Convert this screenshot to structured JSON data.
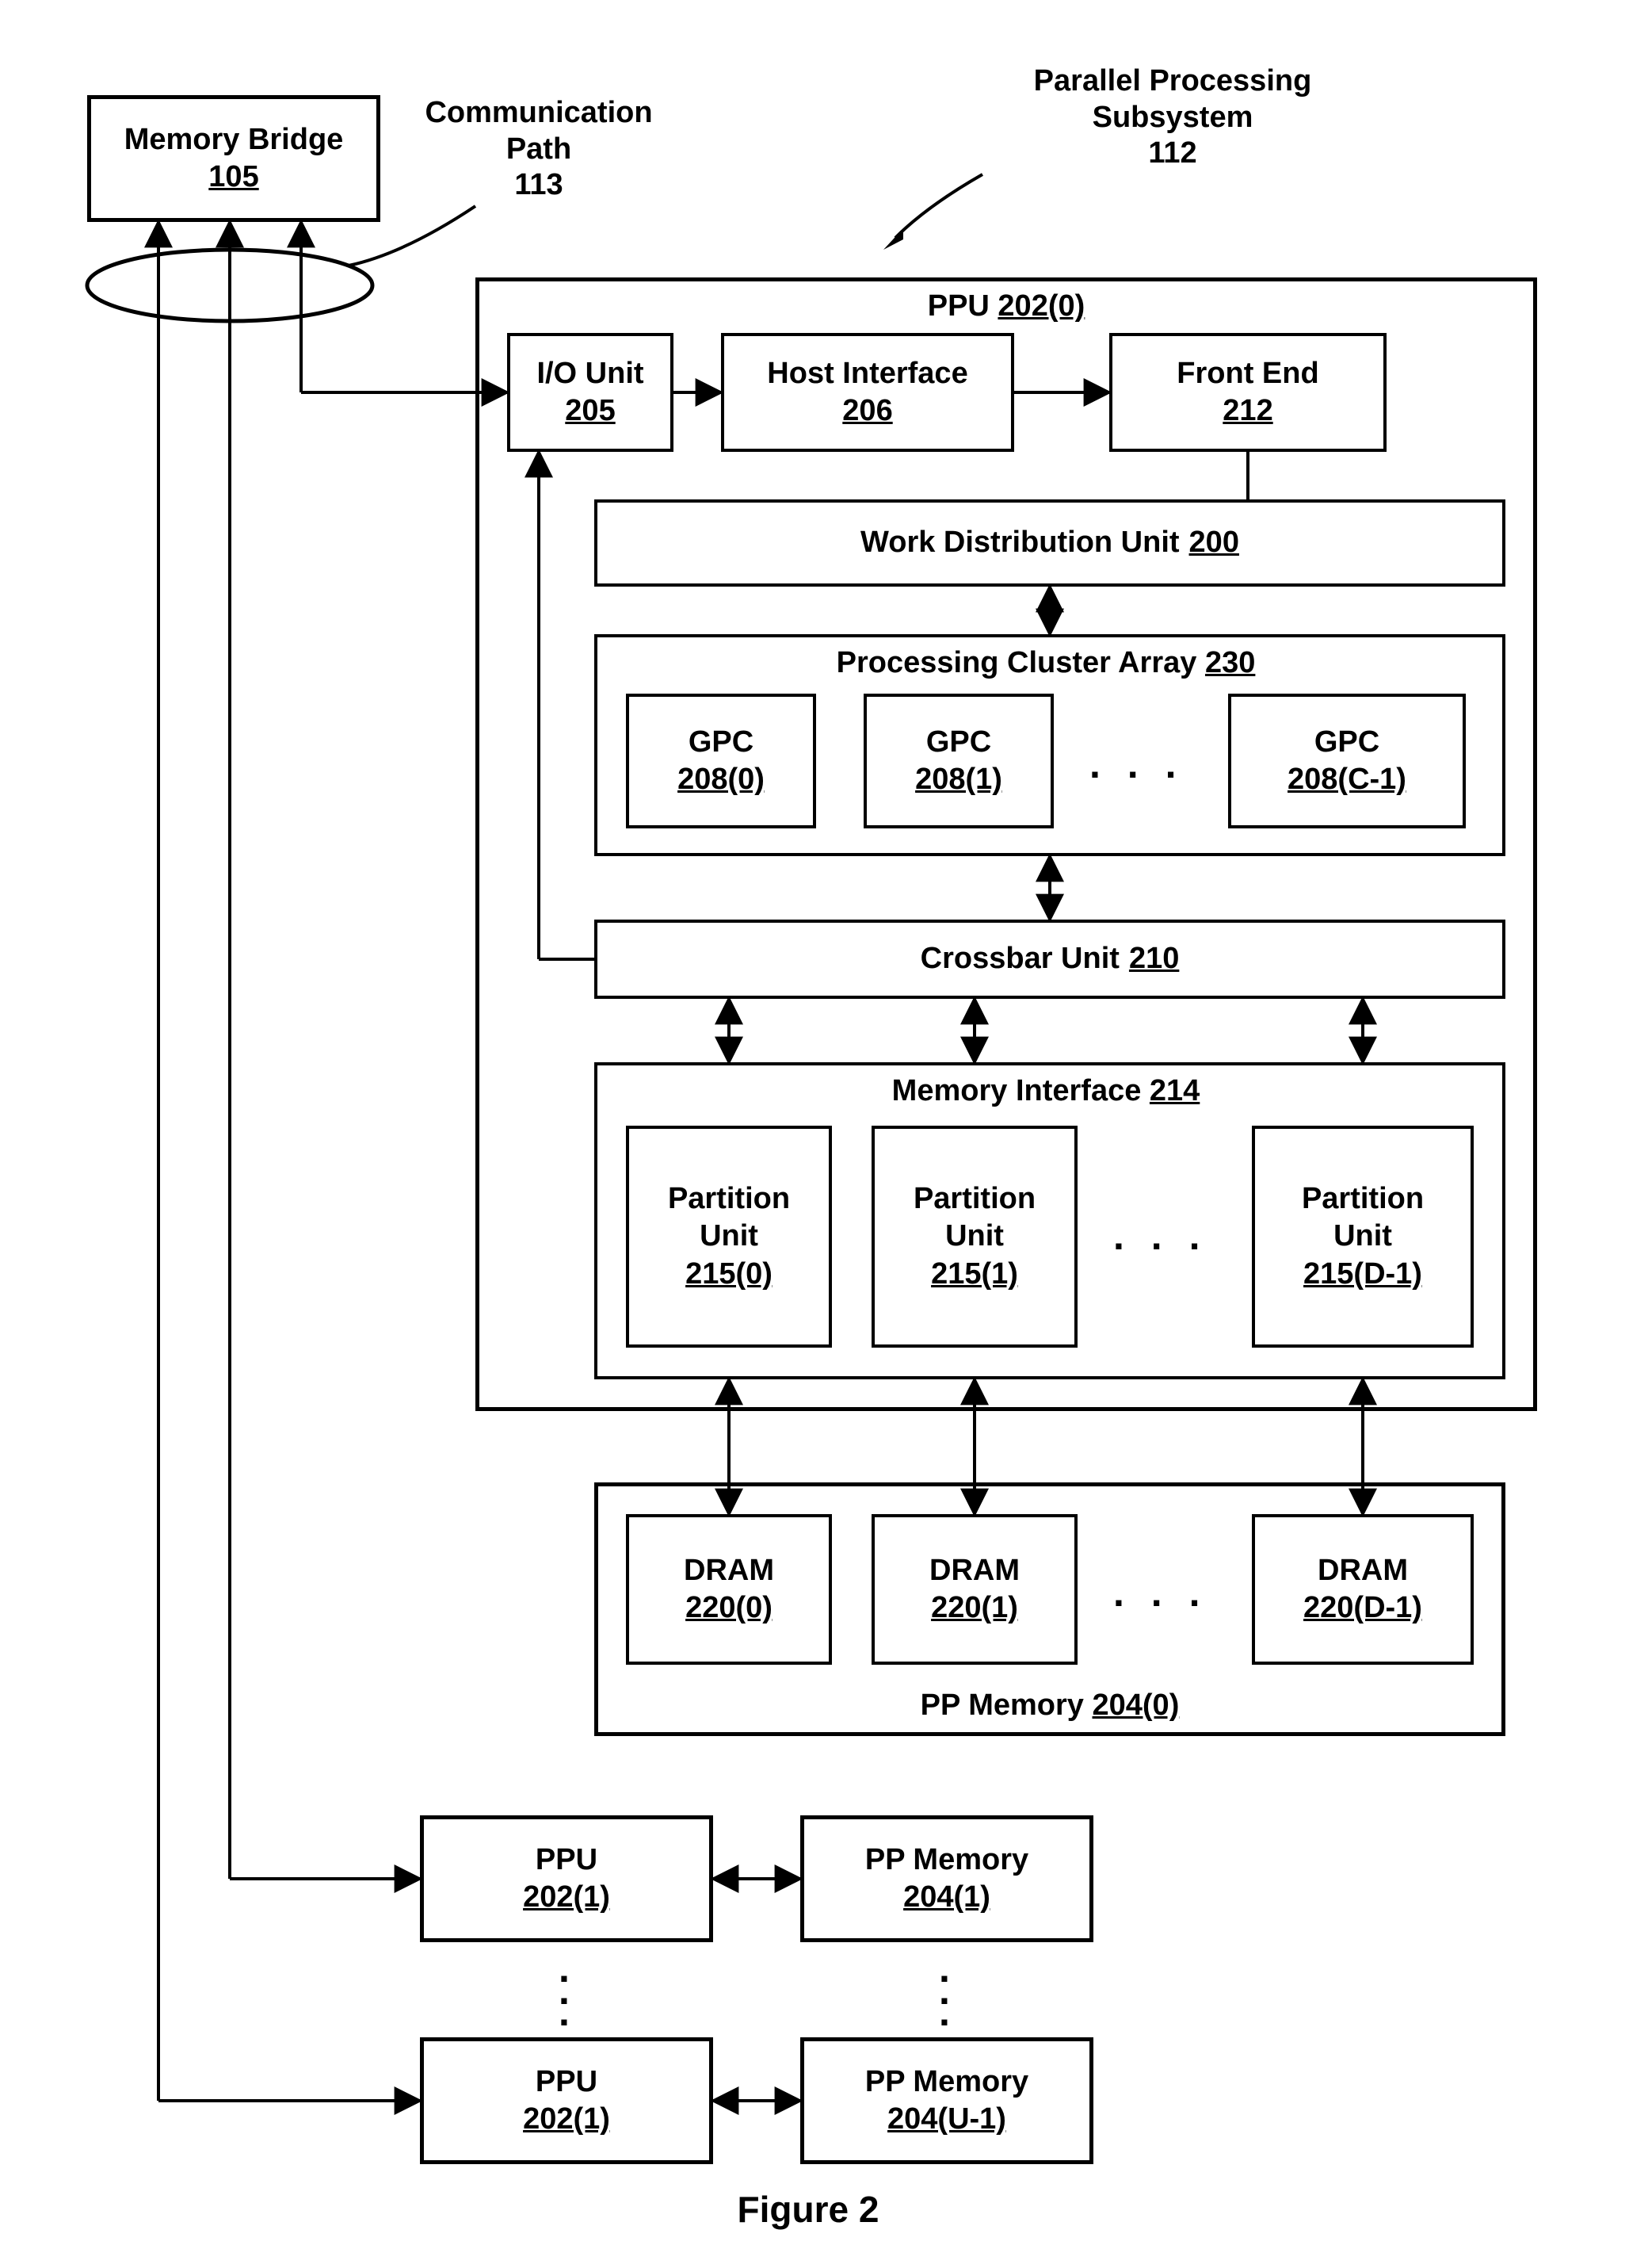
{
  "memory_bridge": {
    "title": "Memory Bridge",
    "num": "105"
  },
  "comm_path": {
    "title": "Communication",
    "title2": "Path",
    "num": "113"
  },
  "pps": {
    "title": "Parallel Processing",
    "title2": "Subsystem",
    "num": "112"
  },
  "ppu0": {
    "title": "PPU",
    "num": "202(0)"
  },
  "io_unit": {
    "title": "I/O Unit",
    "num": "205"
  },
  "host_if": {
    "title": "Host Interface",
    "num": "206"
  },
  "front_end": {
    "title": "Front End",
    "num": "212"
  },
  "wdu": {
    "title": "Work Distribution Unit",
    "num": "200"
  },
  "pca": {
    "title": "Processing Cluster Array",
    "num": "230"
  },
  "gpc0": {
    "title": "GPC",
    "num": "208(0)"
  },
  "gpc1": {
    "title": "GPC",
    "num": "208(1)"
  },
  "gpcC": {
    "title": "GPC",
    "num": "208(C-1)"
  },
  "xbar": {
    "title": "Crossbar Unit",
    "num": "210"
  },
  "memif": {
    "title": "Memory Interface",
    "num": "214"
  },
  "pu0": {
    "title": "Partition",
    "title2": "Unit",
    "num": "215(0)"
  },
  "pu1": {
    "title": "Partition",
    "title2": "Unit",
    "num": "215(1)"
  },
  "puD": {
    "title": "Partition",
    "title2": "Unit",
    "num": "215(D-1)"
  },
  "ppmem0": {
    "title": "PP Memory",
    "num": "204(0)"
  },
  "dram0": {
    "title": "DRAM",
    "num": "220(0)"
  },
  "dram1": {
    "title": "DRAM",
    "num": "220(1)"
  },
  "dramD": {
    "title": "DRAM",
    "num": "220(D-1)"
  },
  "ppu1": {
    "title": "PPU",
    "num": "202(1)"
  },
  "ppmem1": {
    "title": "PP Memory",
    "num": "204(1)"
  },
  "ppuU": {
    "title": "PPU",
    "num": "202(1)"
  },
  "ppmemU": {
    "title": "PP Memory",
    "num": "204(U-1)"
  },
  "figure": "Figure 2",
  "ellipsis": ". . ."
}
